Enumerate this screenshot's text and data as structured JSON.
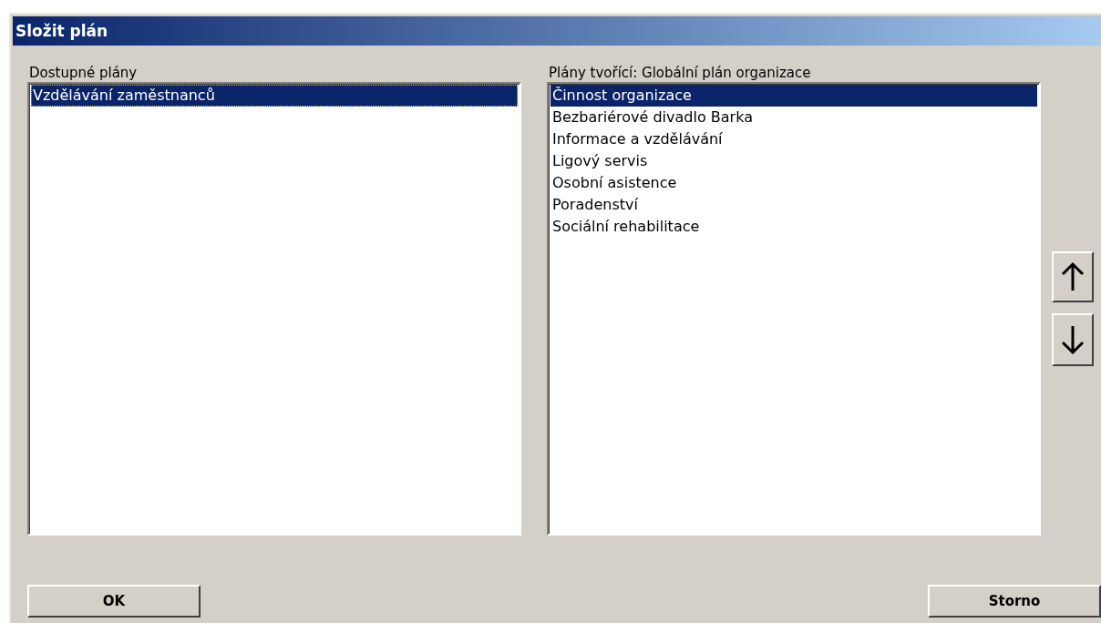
{
  "window": {
    "title": "Složit plán"
  },
  "available": {
    "label": "Dostupné plány",
    "items": [
      {
        "label": "Vzdělávání zaměstnanců",
        "selected": true
      }
    ]
  },
  "composing": {
    "label": "Plány tvořící: Globální plán organizace",
    "items": [
      {
        "label": "Činnost organizace",
        "selected": true
      },
      {
        "label": "Bezbariérové divadlo Barka",
        "selected": false
      },
      {
        "label": "Informace a vzdělávání",
        "selected": false
      },
      {
        "label": "Ligový servis",
        "selected": false
      },
      {
        "label": "Osobní asistence",
        "selected": false
      },
      {
        "label": "Poradenství",
        "selected": false
      },
      {
        "label": "Sociální rehabilitace",
        "selected": false
      }
    ]
  },
  "buttons": [
    {
      "label": "OK"
    },
    {
      "label": "Storno"
    }
  ]
}
